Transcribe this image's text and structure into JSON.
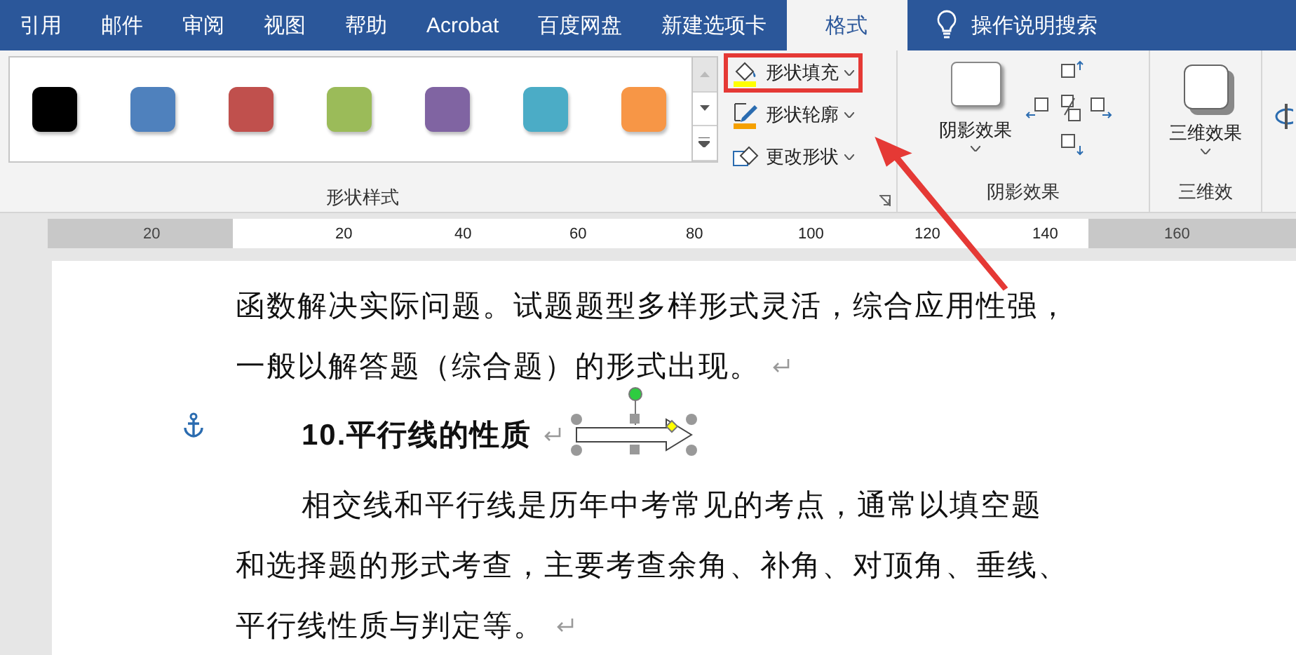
{
  "tabs": [
    {
      "label": "引用",
      "selected": false
    },
    {
      "label": "邮件",
      "selected": false
    },
    {
      "label": "审阅",
      "selected": false
    },
    {
      "label": "视图",
      "selected": false
    },
    {
      "label": "帮助",
      "selected": false
    },
    {
      "label": "Acrobat",
      "selected": false
    },
    {
      "label": "百度网盘",
      "selected": false
    },
    {
      "label": "新建选项卡",
      "selected": false
    },
    {
      "label": "格式",
      "selected": true
    }
  ],
  "search": {
    "label": "操作说明搜索"
  },
  "ribbon": {
    "shape_styles": {
      "swatches": [
        {
          "color": "#000000"
        },
        {
          "color": "#4f81bd"
        },
        {
          "color": "#c0504d"
        },
        {
          "color": "#9bbb59"
        },
        {
          "color": "#8064a2"
        },
        {
          "color": "#4bacc6"
        },
        {
          "color": "#f79646"
        }
      ],
      "label": "形状样式"
    },
    "shape_commands": [
      {
        "kind": "fill",
        "label": "形状填充",
        "highlighted": true
      },
      {
        "kind": "outline",
        "label": "形状轮廓",
        "highlighted": false
      },
      {
        "kind": "change",
        "label": "更改形状",
        "highlighted": false
      }
    ],
    "shadow": {
      "button": "阴影效果",
      "label": "阴影效果"
    },
    "three_d": {
      "button": "三维效果",
      "label": "三维效"
    }
  },
  "ruler": {
    "labels": [
      {
        "text": "20",
        "margin": true
      },
      {
        "text": "20",
        "margin": false
      },
      {
        "text": "40",
        "margin": false
      },
      {
        "text": "60",
        "margin": false
      },
      {
        "text": "80",
        "margin": false
      },
      {
        "text": "100",
        "margin": false
      },
      {
        "text": "120",
        "margin": false
      },
      {
        "text": "140",
        "margin": false
      },
      {
        "text": "160",
        "margin": true
      }
    ]
  },
  "document": {
    "paragraphs": [
      {
        "kind": "body",
        "indent": false,
        "text": "函数解决实际问题。试题题型多样形式灵活，综合应用性强，",
        "mark": false
      },
      {
        "kind": "body",
        "indent": false,
        "text": "一般以解答题（综合题）的形式出现。",
        "mark": true
      },
      {
        "kind": "heading",
        "indent": true,
        "text": "10.平行线的性质",
        "mark": true
      },
      {
        "kind": "body",
        "indent": true,
        "text": "相交线和平行线是历年中考常见的考点，通常以填空题",
        "mark": false
      },
      {
        "kind": "body",
        "indent": false,
        "text": "和选择题的形式考查，主要考查余角、补角、对顶角、垂线、",
        "mark": false
      },
      {
        "kind": "body",
        "indent": false,
        "text": "平行线性质与判定等。",
        "mark": true
      }
    ]
  }
}
